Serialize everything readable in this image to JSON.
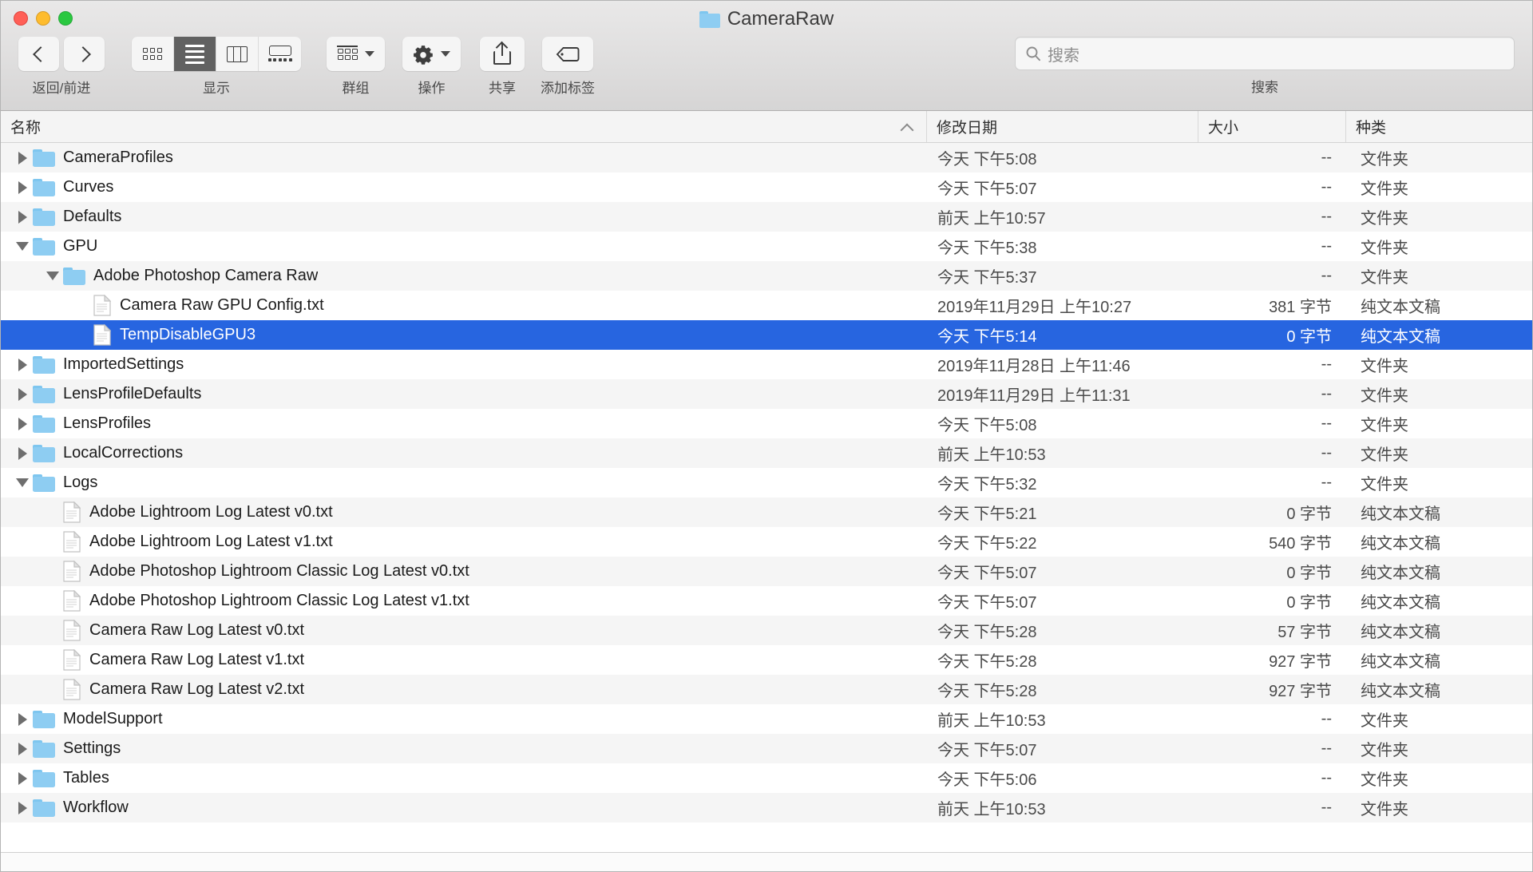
{
  "window": {
    "title": "CameraRaw",
    "title_icon": "folder-icon",
    "traffic_lights": [
      "close-button",
      "minimize-button",
      "maximize-button"
    ]
  },
  "toolbar": {
    "nav": {
      "caption": "返回/前进",
      "back_icon": "chevron-left-icon",
      "forward_icon": "chevron-right-icon"
    },
    "view": {
      "caption": "显示",
      "options": [
        "icon-view",
        "list-view",
        "column-view",
        "gallery-view"
      ],
      "active": "list-view"
    },
    "group": {
      "caption": "群组",
      "icon": "group-grid-icon"
    },
    "action": {
      "caption": "操作",
      "icon": "gear-icon"
    },
    "share": {
      "caption": "共享",
      "icon": "share-icon"
    },
    "tag": {
      "caption": "添加标签",
      "icon": "tag-icon"
    },
    "search": {
      "caption": "搜索",
      "placeholder": "搜索",
      "value": "",
      "icon": "search-icon"
    }
  },
  "columns": {
    "name": "名称",
    "date": "修改日期",
    "size": "大小",
    "kind": "种类",
    "sort_by": "name",
    "sort_dir": "asc"
  },
  "colors": {
    "selection": "#2765e0",
    "folder": "#8ecdf2",
    "toolbar_bg": "#dedddd"
  },
  "rows": [
    {
      "name": "CameraProfiles",
      "type": "folder",
      "indent": 0,
      "disclosure": "closed",
      "date": "今天 下午5:08",
      "size": "--",
      "kind": "文件夹",
      "selected": false
    },
    {
      "name": "Curves",
      "type": "folder",
      "indent": 0,
      "disclosure": "closed",
      "date": "今天 下午5:07",
      "size": "--",
      "kind": "文件夹",
      "selected": false
    },
    {
      "name": "Defaults",
      "type": "folder",
      "indent": 0,
      "disclosure": "closed",
      "date": "前天 上午10:57",
      "size": "--",
      "kind": "文件夹",
      "selected": false
    },
    {
      "name": "GPU",
      "type": "folder",
      "indent": 0,
      "disclosure": "open",
      "date": "今天 下午5:38",
      "size": "--",
      "kind": "文件夹",
      "selected": false
    },
    {
      "name": "Adobe Photoshop Camera Raw",
      "type": "folder",
      "indent": 1,
      "disclosure": "open",
      "date": "今天 下午5:37",
      "size": "--",
      "kind": "文件夹",
      "selected": false
    },
    {
      "name": "Camera Raw GPU Config.txt",
      "type": "file",
      "indent": 2,
      "disclosure": "none",
      "date": "2019年11月29日 上午10:27",
      "size": "381 字节",
      "kind": "纯文本文稿",
      "selected": false
    },
    {
      "name": "TempDisableGPU3",
      "type": "file",
      "indent": 2,
      "disclosure": "none",
      "date": "今天 下午5:14",
      "size": "0 字节",
      "kind": "纯文本文稿",
      "selected": true
    },
    {
      "name": "ImportedSettings",
      "type": "folder",
      "indent": 0,
      "disclosure": "closed",
      "date": "2019年11月28日 上午11:46",
      "size": "--",
      "kind": "文件夹",
      "selected": false
    },
    {
      "name": "LensProfileDefaults",
      "type": "folder",
      "indent": 0,
      "disclosure": "closed",
      "date": "2019年11月29日 上午11:31",
      "size": "--",
      "kind": "文件夹",
      "selected": false
    },
    {
      "name": "LensProfiles",
      "type": "folder",
      "indent": 0,
      "disclosure": "closed",
      "date": "今天 下午5:08",
      "size": "--",
      "kind": "文件夹",
      "selected": false
    },
    {
      "name": "LocalCorrections",
      "type": "folder",
      "indent": 0,
      "disclosure": "closed",
      "date": "前天 上午10:53",
      "size": "--",
      "kind": "文件夹",
      "selected": false
    },
    {
      "name": "Logs",
      "type": "folder",
      "indent": 0,
      "disclosure": "open",
      "date": "今天 下午5:32",
      "size": "--",
      "kind": "文件夹",
      "selected": false
    },
    {
      "name": "Adobe Lightroom Log Latest v0.txt",
      "type": "file",
      "indent": 1,
      "disclosure": "none",
      "date": "今天 下午5:21",
      "size": "0 字节",
      "kind": "纯文本文稿",
      "selected": false
    },
    {
      "name": "Adobe Lightroom Log Latest v1.txt",
      "type": "file",
      "indent": 1,
      "disclosure": "none",
      "date": "今天 下午5:22",
      "size": "540 字节",
      "kind": "纯文本文稿",
      "selected": false
    },
    {
      "name": "Adobe Photoshop Lightroom Classic Log Latest v0.txt",
      "type": "file",
      "indent": 1,
      "disclosure": "none",
      "date": "今天 下午5:07",
      "size": "0 字节",
      "kind": "纯文本文稿",
      "selected": false
    },
    {
      "name": "Adobe Photoshop Lightroom Classic Log Latest v1.txt",
      "type": "file",
      "indent": 1,
      "disclosure": "none",
      "date": "今天 下午5:07",
      "size": "0 字节",
      "kind": "纯文本文稿",
      "selected": false
    },
    {
      "name": "Camera Raw Log Latest v0.txt",
      "type": "file",
      "indent": 1,
      "disclosure": "none",
      "date": "今天 下午5:28",
      "size": "57 字节",
      "kind": "纯文本文稿",
      "selected": false
    },
    {
      "name": "Camera Raw Log Latest v1.txt",
      "type": "file",
      "indent": 1,
      "disclosure": "none",
      "date": "今天 下午5:28",
      "size": "927 字节",
      "kind": "纯文本文稿",
      "selected": false
    },
    {
      "name": "Camera Raw Log Latest v2.txt",
      "type": "file",
      "indent": 1,
      "disclosure": "none",
      "date": "今天 下午5:28",
      "size": "927 字节",
      "kind": "纯文本文稿",
      "selected": false
    },
    {
      "name": "ModelSupport",
      "type": "folder",
      "indent": 0,
      "disclosure": "closed",
      "date": "前天 上午10:53",
      "size": "--",
      "kind": "文件夹",
      "selected": false
    },
    {
      "name": "Settings",
      "type": "folder",
      "indent": 0,
      "disclosure": "closed",
      "date": "今天 下午5:07",
      "size": "--",
      "kind": "文件夹",
      "selected": false
    },
    {
      "name": "Tables",
      "type": "folder",
      "indent": 0,
      "disclosure": "closed",
      "date": "今天 下午5:06",
      "size": "--",
      "kind": "文件夹",
      "selected": false
    },
    {
      "name": "Workflow",
      "type": "folder",
      "indent": 0,
      "disclosure": "closed",
      "date": "前天 上午10:53",
      "size": "--",
      "kind": "文件夹",
      "selected": false
    }
  ]
}
